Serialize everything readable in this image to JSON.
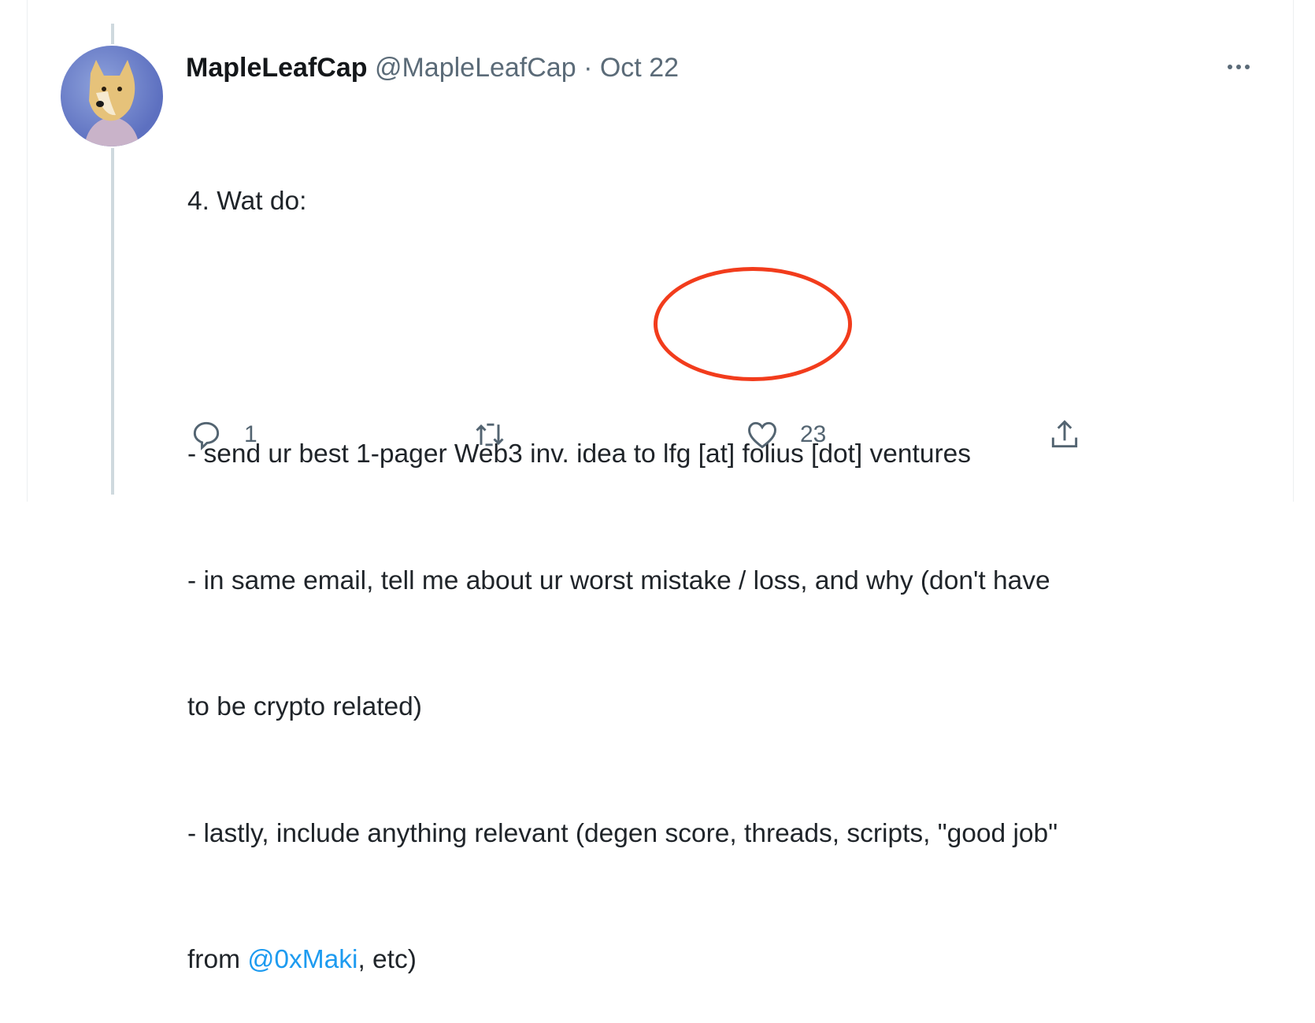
{
  "tweet": {
    "display_name": "MapleLeafCap",
    "handle": "@MapleLeafCap",
    "separator": "·",
    "date": "Oct 22",
    "more_icon": "more-horizontal-icon",
    "lines": {
      "l0": "4. Wat do:",
      "l1": "",
      "l2": "- send ur best 1-pager Web3 inv. idea to lfg [at] folius [dot] ventures",
      "l3": "- in same email, tell me about ur worst mistake / loss, and why (don't have",
      "l4": "to be crypto related)",
      "l5a": "- lastly, include anything relevant ",
      "l5b": "(degen score,",
      "l5c": " threads, scripts, \"good job\"",
      "l6a": "from ",
      "l6_mention": "@0xMaki",
      "l6b": ", etc)"
    },
    "annotation": {
      "shape": "red-ellipse",
      "target": "(degen score,",
      "color": "#f23c1c"
    },
    "actions": {
      "reply": {
        "icon": "reply-icon",
        "count": "1"
      },
      "retweet": {
        "icon": "retweet-icon",
        "count": ""
      },
      "like": {
        "icon": "heart-icon",
        "count": "23"
      },
      "share": {
        "icon": "share-icon"
      }
    }
  },
  "colors": {
    "text": "#1f2429",
    "secondary": "#536471",
    "link": "#1d9bf0",
    "thread_line": "#cfd9de"
  }
}
